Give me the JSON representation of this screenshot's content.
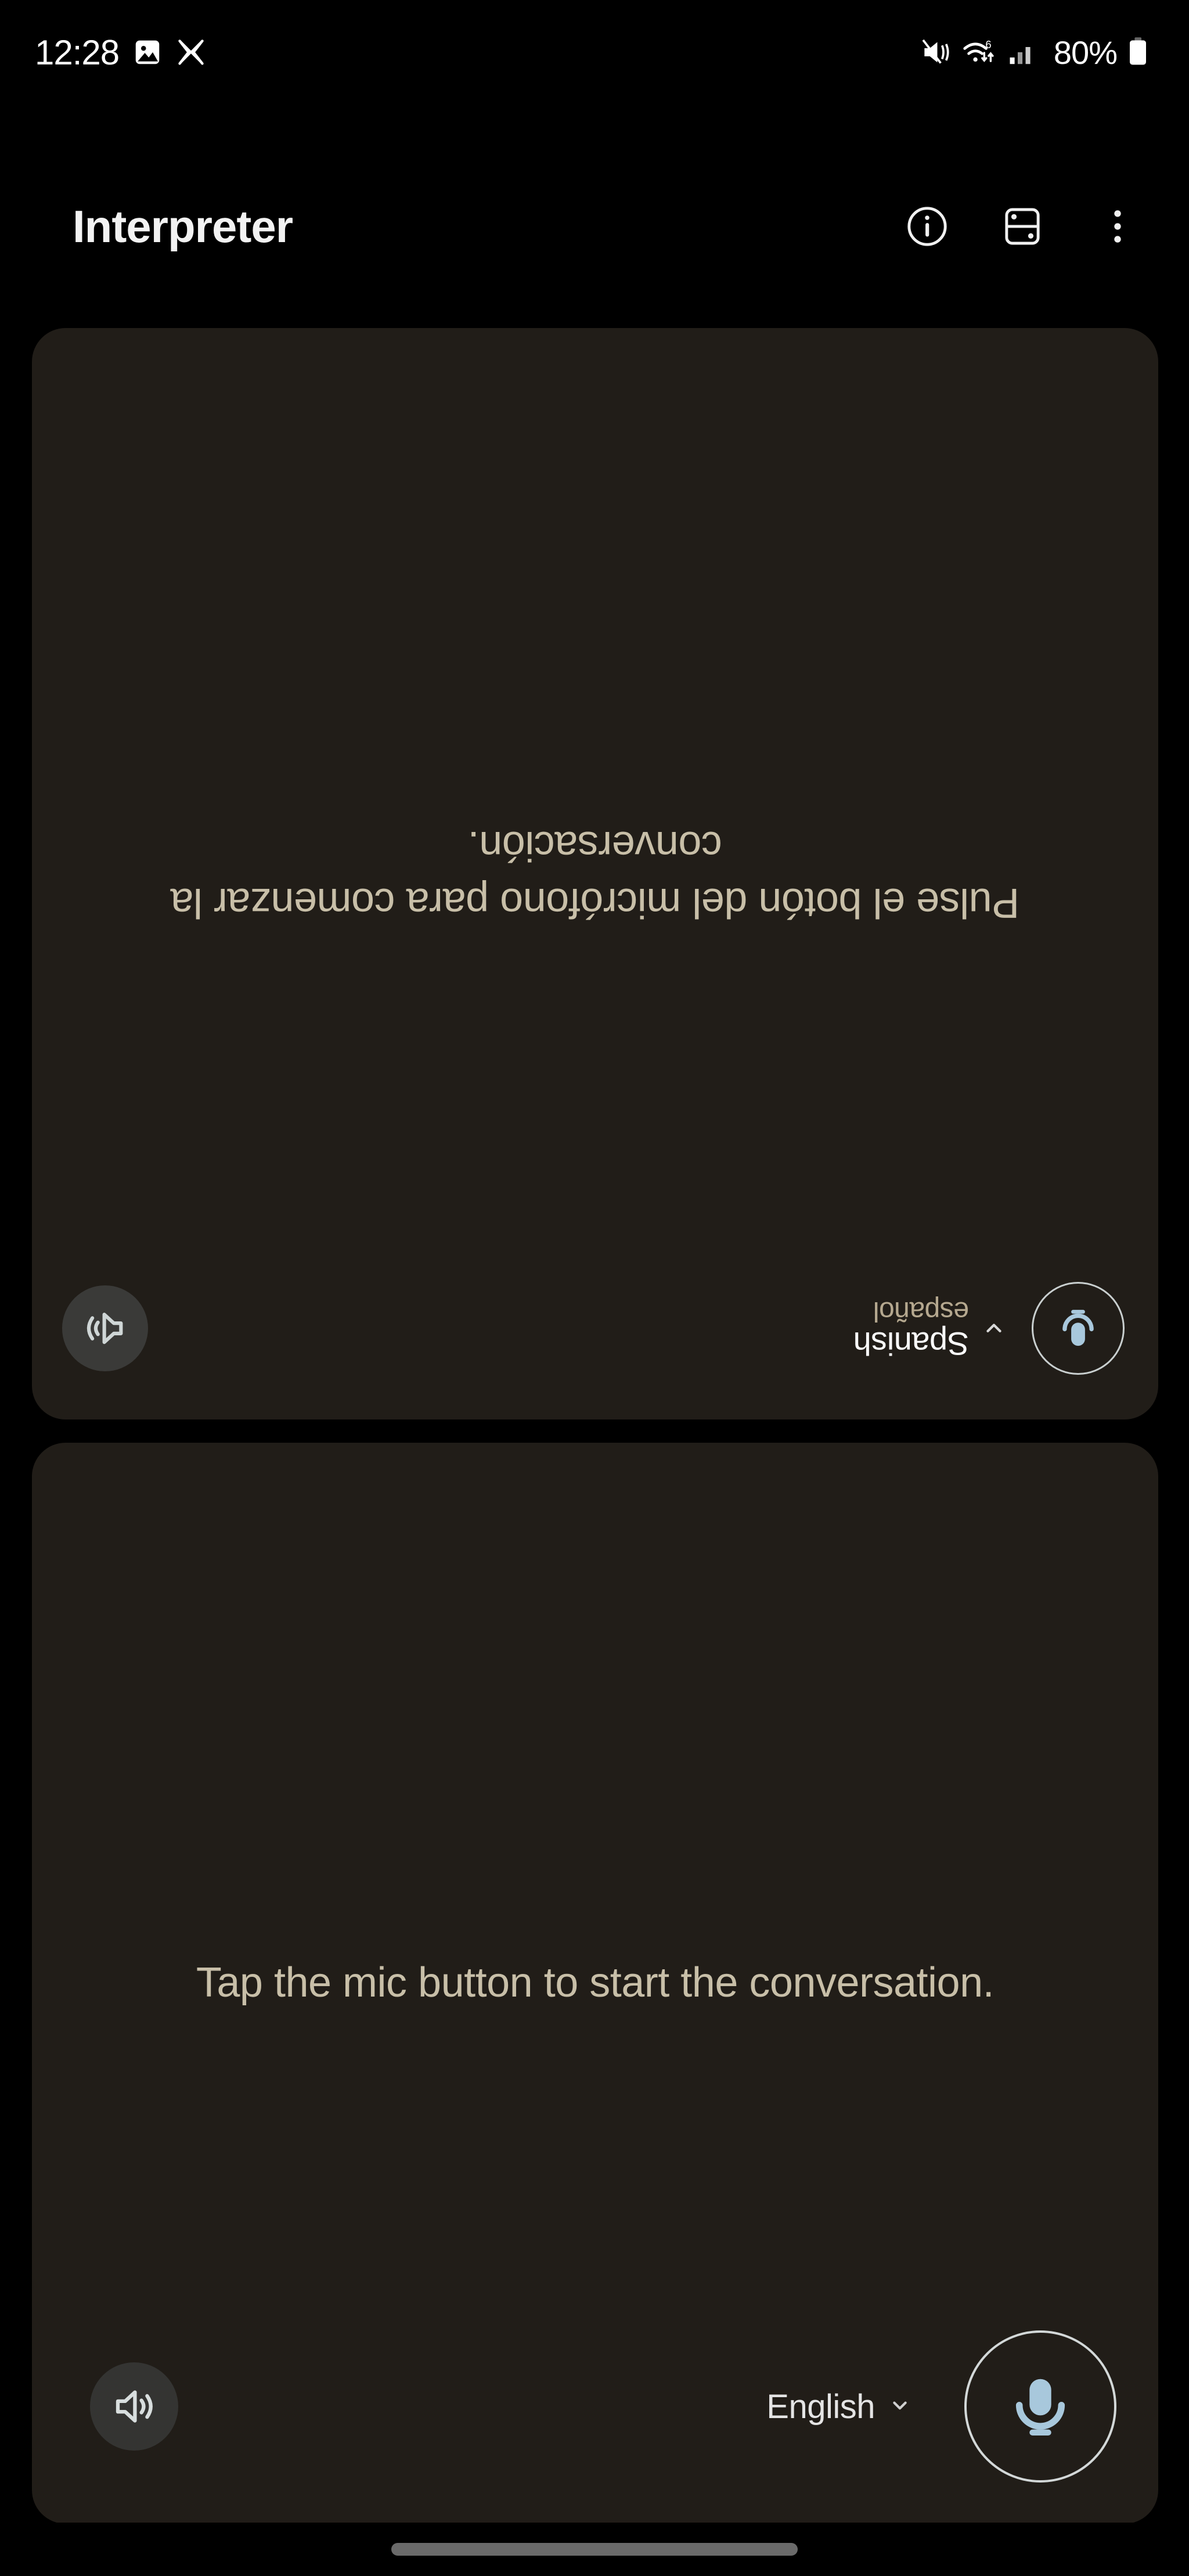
{
  "status_bar": {
    "time": "12:28",
    "battery_percent": "80%",
    "icons": [
      "photo-icon",
      "x-app-icon",
      "mute-vibrate-icon",
      "wifi-6-icon",
      "signal-bars-icon",
      "battery-icon"
    ]
  },
  "header": {
    "title": "Interpreter",
    "actions": [
      {
        "name": "info-icon",
        "label": "Info"
      },
      {
        "name": "split-screen-icon",
        "label": "Split screen"
      },
      {
        "name": "overflow-menu-icon",
        "label": "More options"
      }
    ]
  },
  "top_panel": {
    "language_main": "Spanish",
    "language_sub": "español",
    "message": "Pulse el botón del micrófono para comenzar la conversación.",
    "mic_icon": "microphone-icon",
    "chevron_icon": "chevron-down-icon",
    "speaker_icon": "speaker-on-icon"
  },
  "bottom_panel": {
    "message": "Tap the mic button to start the conversation.",
    "speaker_icon": "speaker-on-icon",
    "language_label": "English",
    "chevron_icon": "chevron-down-icon",
    "mic_icon": "microphone-icon"
  },
  "nav": {
    "handle": "gesture-handle"
  },
  "colors": {
    "background": "#000000",
    "card": "#211d18",
    "message_text": "#c8bfa8",
    "accent_mic": "#a8c8dc",
    "lang_sub": "#b5a88f",
    "primary_text": "#f2f2f2"
  }
}
